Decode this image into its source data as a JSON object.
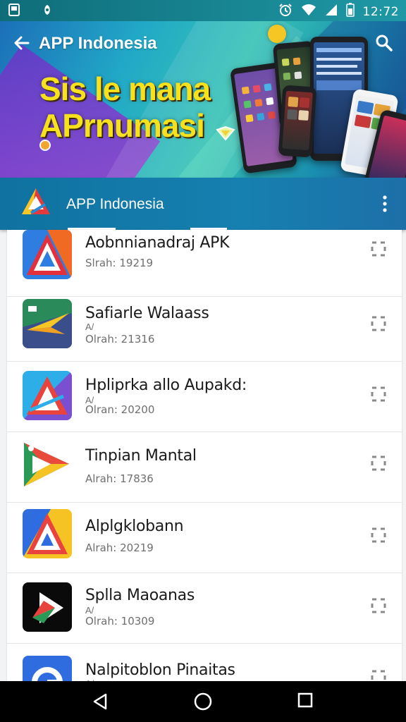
{
  "status_bar": {
    "time": "12:72",
    "icons": [
      "notification-icon",
      "app-icon",
      "alarm-icon",
      "wifi-icon",
      "signal-icon",
      "battery-icon"
    ]
  },
  "banner": {
    "title": "APP Indonesia",
    "headline_line1": "Sis le mana",
    "headline_line2": "APrnumasi",
    "colors": {
      "headline": "#f6e11c",
      "accent": "#1a8fb0"
    }
  },
  "app_bar": {
    "title": "APP Indonesia"
  },
  "apps": [
    {
      "name": "Aobnnianadraj APK",
      "marker": "",
      "size": "Slrah: 19219",
      "icon": "red-triangle-a-icon"
    },
    {
      "name": "Safiarle Walaass",
      "marker": "A/",
      "size": "Olrah: 21316",
      "icon": "yellow-arrow-icon"
    },
    {
      "name": "Hpliprka allo Aupakd:",
      "marker": "A/",
      "size": "Olran: 20200",
      "icon": "blue-triangle-icon"
    },
    {
      "name": "Tinpian Mantal",
      "marker": "",
      "size": "Alrah: 17836",
      "icon": "green-triangle-icon"
    },
    {
      "name": "Alplgklobann",
      "marker": "",
      "size": "Alrah: 20219",
      "icon": "yellow-a-icon"
    },
    {
      "name": "Splla Maoanas",
      "marker": "A/",
      "size": "Olrah: 10309",
      "icon": "play-icon"
    },
    {
      "name": "Nalpitoblon Pinaitas",
      "marker": "A/",
      "size": "",
      "icon": "g-logo-icon"
    }
  ]
}
